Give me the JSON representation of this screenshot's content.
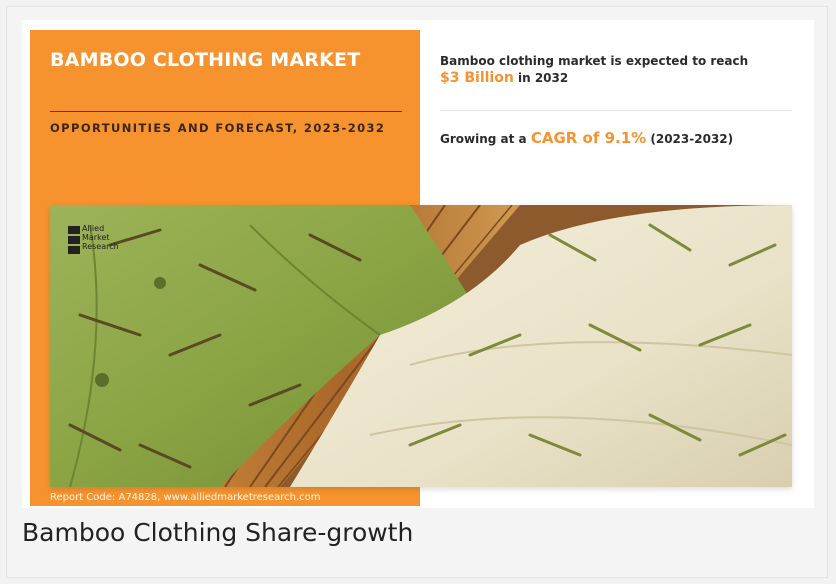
{
  "infographic": {
    "title": "BAMBOO CLOTHING MARKET",
    "subtitle": "OPPORTUNITIES AND FORECAST, 2023-2032",
    "stat1": {
      "prefix": "Bamboo clothing market is expected to reach",
      "value": "$3 Billion",
      "suffix": "in 2032"
    },
    "stat2": {
      "prefix": "Growing at a",
      "value": "CAGR of 9.1%",
      "suffix": "(2023-2032)"
    },
    "logo_text": [
      "Allied",
      "Market",
      "Research"
    ],
    "report_code": "Report Code: A74828, www.alliedmarketresearch.com"
  },
  "caption": "Bamboo Clothing Share-growth",
  "colors": {
    "accent": "#f7932f",
    "panel_text": "#ffffff",
    "green_fabric": "#8fa84a",
    "cream_fabric": "#ece6cf",
    "bamboo": "#b7742e"
  },
  "icons": {
    "logo": "allied-market-research-logo-icon"
  }
}
